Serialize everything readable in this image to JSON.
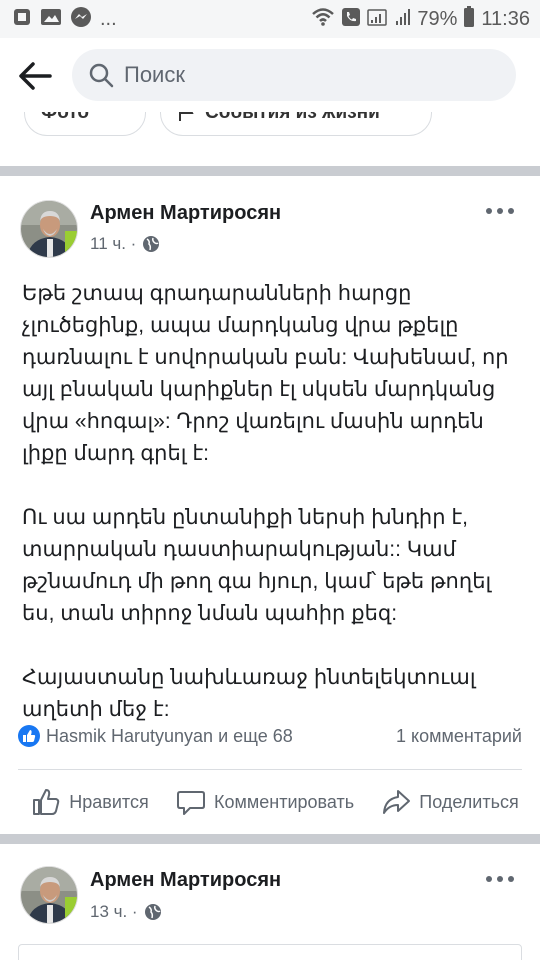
{
  "status_bar": {
    "left_more": "...",
    "battery": "79%",
    "time": "11:36"
  },
  "header": {
    "search_placeholder": "Поиск"
  },
  "chips": [
    {
      "label": "Фото"
    },
    {
      "label": "События из жизни"
    }
  ],
  "posts": [
    {
      "author": "Армен Мартиросян",
      "time": "11 ч. ·",
      "paragraphs": [
        "Եթե շտապ գրադարանների հարցը չլուծեցինք, ապա մարդկանց վրա թքելը դառնալու է սովորական բան: Վախենամ, որ այլ բնական կարիքներ էլ սկսեն մարդկանց վրա «հոգալ»: Դրոշ վառելու մասին արդեն լիքը մարդ գրել է:",
        "Ու սա արդեն ընտանիքի ներսի խնդիր է, տարրական դաստիարակության:: Կամ թշնամուդ մի թող գա հյուր, կամ՝ եթե թողել ես, տան տիրոջ նման պահիր քեզ:",
        "Հայաստանը նախևառաջ ինտելեկտուալ աղետի մեջ է:"
      ],
      "reactions_text": "Hasmik Harutyunyan и еще 68",
      "comments_text": "1 комментарий",
      "actions": {
        "like": "Нравится",
        "comment": "Комментировать",
        "share": "Поделиться"
      }
    },
    {
      "author": "Армен Мартиросян",
      "time": "13 ч. ·"
    }
  ]
}
